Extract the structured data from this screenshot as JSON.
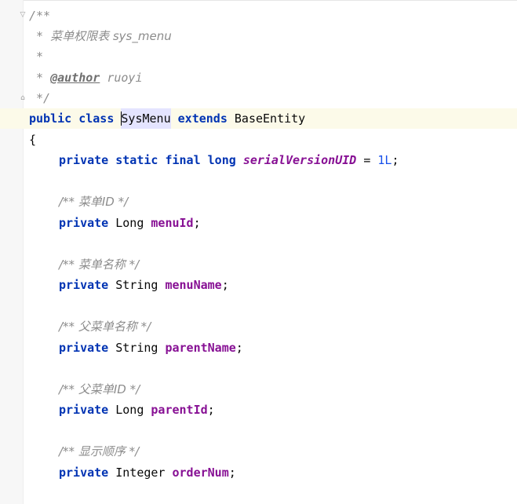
{
  "editor": {
    "language": "java",
    "code": {
      "javadoc_open": "/**",
      "javadoc_line1_star": " * ",
      "javadoc_line1_text": "菜单权限表 sys_menu",
      "javadoc_line2": " *",
      "javadoc_line3_star": " * ",
      "javadoc_author_tag": "@author",
      "javadoc_author_name": " ruoyi",
      "javadoc_close": " */",
      "class_decl": {
        "kw_public": "public",
        "kw_class": "class",
        "class_name": "SysMenu",
        "kw_extends": "extends",
        "parent": "BaseEntity"
      },
      "open_brace": "{",
      "serial": {
        "kw_private": "private",
        "kw_static": "static",
        "kw_final": "final",
        "kw_long": "long",
        "name": "serialVersionUID",
        "eq": " = ",
        "value": "1L",
        "semi": ";"
      },
      "fields": [
        {
          "comment": "/** 菜单ID */",
          "kw": "private",
          "type": "Long",
          "name": "menuId",
          "semi": ";"
        },
        {
          "comment": "/** 菜单名称 */",
          "kw": "private",
          "type": "String",
          "name": "menuName",
          "semi": ";"
        },
        {
          "comment": "/** 父菜单名称 */",
          "kw": "private",
          "type": "String",
          "name": "parentName",
          "semi": ";"
        },
        {
          "comment": "/** 父菜单ID */",
          "kw": "private",
          "type": "Long",
          "name": "parentId",
          "semi": ";"
        },
        {
          "comment": "/** 显示顺序 */",
          "kw": "private",
          "type": "Integer",
          "name": "orderNum",
          "semi": ";"
        }
      ]
    },
    "colors": {
      "keyword": "#0033b3",
      "field": "#871094",
      "comment": "#8c8c8c",
      "number": "#1750eb",
      "current_line": "#fcfae9",
      "gutter": "#f7f7f7"
    },
    "icons": {
      "fold_open": "fold-open-icon",
      "fold_close": "fold-close-icon"
    }
  }
}
